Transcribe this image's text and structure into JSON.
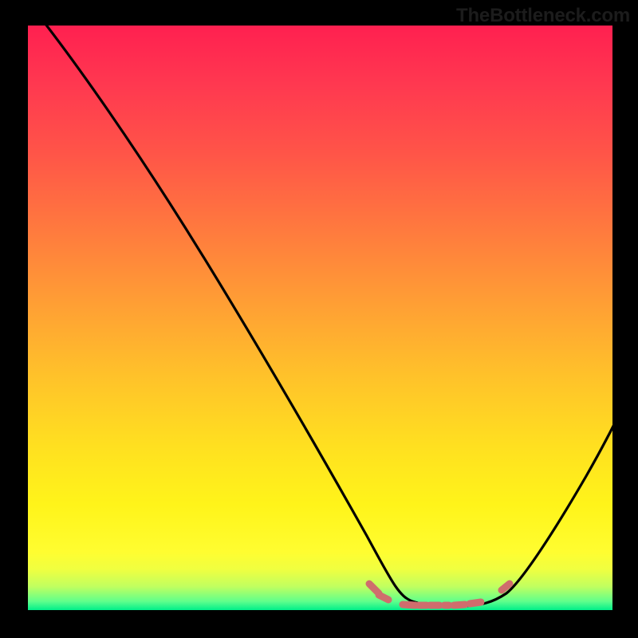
{
  "watermark": "TheBottleneck.com",
  "chart_data": {
    "type": "line",
    "title": "",
    "xlabel": "",
    "ylabel": "",
    "xlim": [
      0,
      100
    ],
    "ylim": [
      0,
      100
    ],
    "series": [
      {
        "name": "curve",
        "x": [
          0,
          5,
          10,
          15,
          20,
          25,
          30,
          35,
          40,
          45,
          50,
          55,
          58,
          61,
          64,
          67,
          70,
          73,
          76,
          79,
          82,
          86,
          90,
          95,
          100
        ],
        "y": [
          105,
          96,
          87,
          78,
          69,
          60,
          51,
          42,
          33,
          24,
          16,
          8,
          4.5,
          2,
          0.8,
          0.3,
          0.1,
          0.1,
          0.2,
          0.6,
          2,
          6,
          12,
          21,
          32
        ]
      }
    ],
    "annotations": [
      {
        "type": "marker-run",
        "x_start": 57,
        "x_end": 80,
        "color": "#d46a6a"
      }
    ],
    "background": {
      "type": "vertical-gradient",
      "stops": [
        {
          "pos": 0.0,
          "color": "#ff2050"
        },
        {
          "pos": 0.5,
          "color": "#ffb030"
        },
        {
          "pos": 0.9,
          "color": "#fffd30"
        },
        {
          "pos": 1.0,
          "color": "#00ef8a"
        }
      ]
    }
  }
}
